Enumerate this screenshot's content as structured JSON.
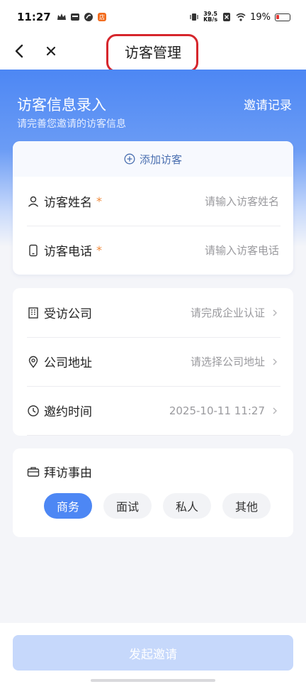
{
  "status_bar": {
    "time": "11:27",
    "net_speed_value": "39.5",
    "net_speed_unit": "KB/s",
    "battery": "19%",
    "battery_color": "#e53935"
  },
  "nav": {
    "title": "访客管理",
    "back_icon": "chevron-left-icon",
    "close_icon": "close-icon"
  },
  "header": {
    "title": "访客信息录入",
    "subtitle": "请完善您邀请的访客信息",
    "invite_record_link": "邀请记录",
    "gradient_color": "#4d87f4"
  },
  "visitor_card": {
    "add_visitor_label": "添加访客",
    "fields": [
      {
        "label": "访客姓名",
        "required_mark": "*",
        "placeholder": "请输入访客姓名",
        "icon": "person-icon"
      },
      {
        "label": "访客电话",
        "required_mark": "*",
        "placeholder": "请输入访客电话",
        "icon": "phone-icon"
      }
    ]
  },
  "visit_card": {
    "rows": [
      {
        "label": "受访公司",
        "value": "请完成企业认证",
        "icon": "building-icon"
      },
      {
        "label": "公司地址",
        "value": "请选择公司地址",
        "icon": "location-pin-icon"
      },
      {
        "label": "邀约时间",
        "value": "2025-10-11 11:27",
        "icon": "clock-icon"
      }
    ]
  },
  "reason_card": {
    "label": "拜访事由",
    "icon": "briefcase-icon",
    "options": [
      "商务",
      "面试",
      "私人",
      "其他"
    ],
    "selected": "商务"
  },
  "submit": {
    "label": "发起邀请",
    "color": "#c6d8fb"
  },
  "accent_color": "#4d87f4",
  "required_color": "#f08a3c"
}
